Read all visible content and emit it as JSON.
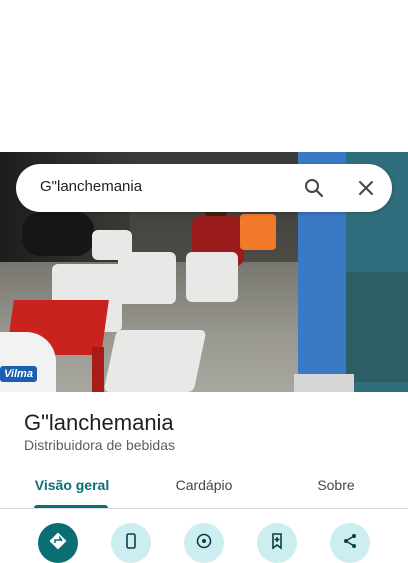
{
  "search": {
    "query": "G\"lanchemania"
  },
  "place": {
    "name": "G\"lanchemania",
    "category": "Distribuidora de bebidas"
  },
  "tabs": [
    {
      "label": "Visão geral",
      "active": true
    },
    {
      "label": "Cardápio",
      "active": false
    },
    {
      "label": "Sobre",
      "active": false
    }
  ],
  "photo": {
    "sign_text": "Vilma"
  },
  "actions": [
    {
      "icon": "directions-icon",
      "primary": true
    },
    {
      "icon": "phone-icon",
      "primary": false
    },
    {
      "icon": "navigation-icon",
      "primary": false
    },
    {
      "icon": "save-icon",
      "primary": false
    },
    {
      "icon": "share-icon",
      "primary": false
    }
  ],
  "colors": {
    "accent": "#0b6e75",
    "action_bg": "#cdeef0"
  }
}
